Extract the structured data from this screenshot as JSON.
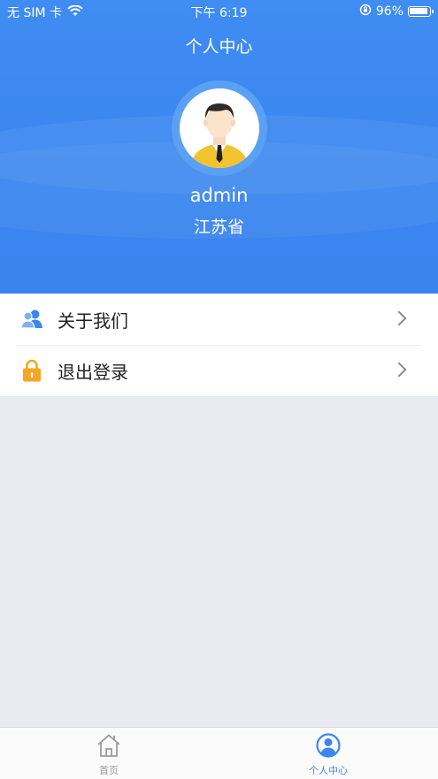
{
  "status": {
    "carrier": "无 SIM 卡",
    "time": "下午 6:19",
    "battery": "96%",
    "battery_level": 0.96
  },
  "header": {
    "title": "个人中心",
    "username": "admin",
    "province": "江苏省"
  },
  "menu": {
    "items": [
      {
        "label": "关于我们",
        "icon": "users-icon"
      },
      {
        "label": "退出登录",
        "icon": "lock-icon"
      }
    ]
  },
  "tabbar": {
    "items": [
      {
        "label": "首页",
        "icon": "home-icon",
        "active": false
      },
      {
        "label": "个人中心",
        "icon": "profile-icon",
        "active": true
      }
    ]
  },
  "colors": {
    "primary": "#3d86f0",
    "lock": "#f5a623",
    "inactive": "#9a9a9a",
    "background": "#e8ebf1"
  }
}
